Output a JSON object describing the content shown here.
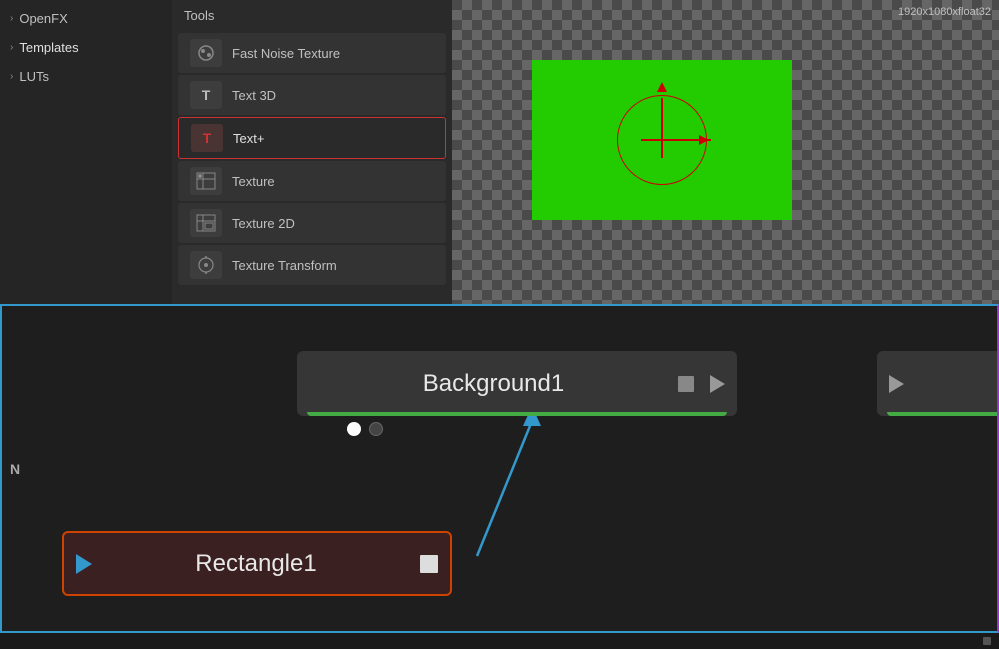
{
  "sidebar": {
    "items": [
      {
        "label": "OpenFX",
        "arrow": "›"
      },
      {
        "label": "Templates",
        "arrow": "›"
      },
      {
        "label": "LUTs",
        "arrow": "›"
      }
    ]
  },
  "tools": {
    "header": "Tools",
    "items": [
      {
        "id": "fast-noise-texture",
        "label": "Fast Noise Texture",
        "icon": "⬡"
      },
      {
        "id": "text-3d",
        "label": "Text 3D",
        "icon": "T"
      },
      {
        "id": "text-plus",
        "label": "Text+",
        "icon": "T",
        "selected": true
      },
      {
        "id": "texture",
        "label": "Texture",
        "icon": "⊞"
      },
      {
        "id": "texture-2d",
        "label": "Texture 2D",
        "icon": "⊟"
      },
      {
        "id": "texture-transform",
        "label": "Texture Transform",
        "icon": "⊕"
      }
    ]
  },
  "preview": {
    "resolution": "1920x1080xfloat32"
  },
  "nodes": {
    "background1": {
      "label": "Background1"
    },
    "rectangle1": {
      "label": "Rectangle1"
    },
    "partial_right": {
      "label": ""
    }
  },
  "left_label": "N"
}
